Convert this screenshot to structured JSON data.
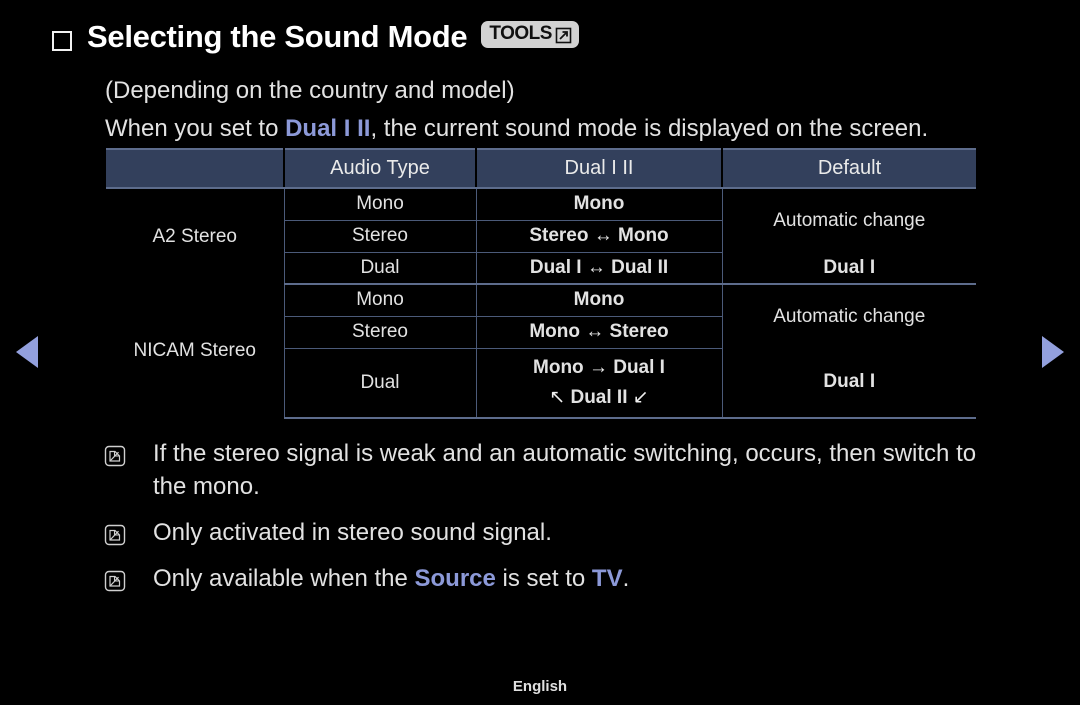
{
  "page": {
    "title": "Selecting the Sound Mode",
    "tools_badge": "TOOLS",
    "footer_language": "English",
    "accent_color": "#8c99d8",
    "header_bg": "#33405c"
  },
  "intro": {
    "line1": "(Depending on the country and model)",
    "line2_pre": "When you set to ",
    "line2_accent": "Dual I II",
    "line2_post": ", the current sound mode is displayed on the screen."
  },
  "table": {
    "headers": {
      "col1": "",
      "col2": "Audio Type",
      "col3": "Dual I II",
      "col4": "Default"
    },
    "rows": [
      {
        "signal": "A2 Stereo",
        "audio_type": "Mono",
        "dual": "Mono",
        "default": "Automatic change"
      },
      {
        "signal": "",
        "audio_type": "Stereo",
        "dual": "Stereo ↔ Mono",
        "default": ""
      },
      {
        "signal": "",
        "audio_type": "Dual",
        "dual": "Dual I ↔ Dual II",
        "default": "Dual I"
      },
      {
        "signal": "NICAM Stereo",
        "audio_type": "Mono",
        "dual": "Mono",
        "default": "Automatic change"
      },
      {
        "signal": "",
        "audio_type": "Stereo",
        "dual": "Mono ↔ Stereo",
        "default": ""
      },
      {
        "signal": "",
        "audio_type": "Dual",
        "dual_line1_pre": "Mono ",
        "dual_line1_arrow": "→",
        "dual_line1_post": " Dual I",
        "dual_line2_arrow_left": "↖",
        "dual_line2_text": "Dual II",
        "dual_line2_arrow_right": "↙",
        "default": "Dual I"
      }
    ]
  },
  "notes": [
    {
      "text": "If the stereo signal is weak and an automatic switching, occurs, then switch to the mono."
    },
    {
      "text": "Only activated in stereo sound signal."
    },
    {
      "pre": "Only available when the ",
      "accent1": "Source",
      "mid": " is set to ",
      "accent2": "TV",
      "post": "."
    }
  ],
  "navigation": {
    "previous_label": "Previous page",
    "next_label": "Next page"
  }
}
